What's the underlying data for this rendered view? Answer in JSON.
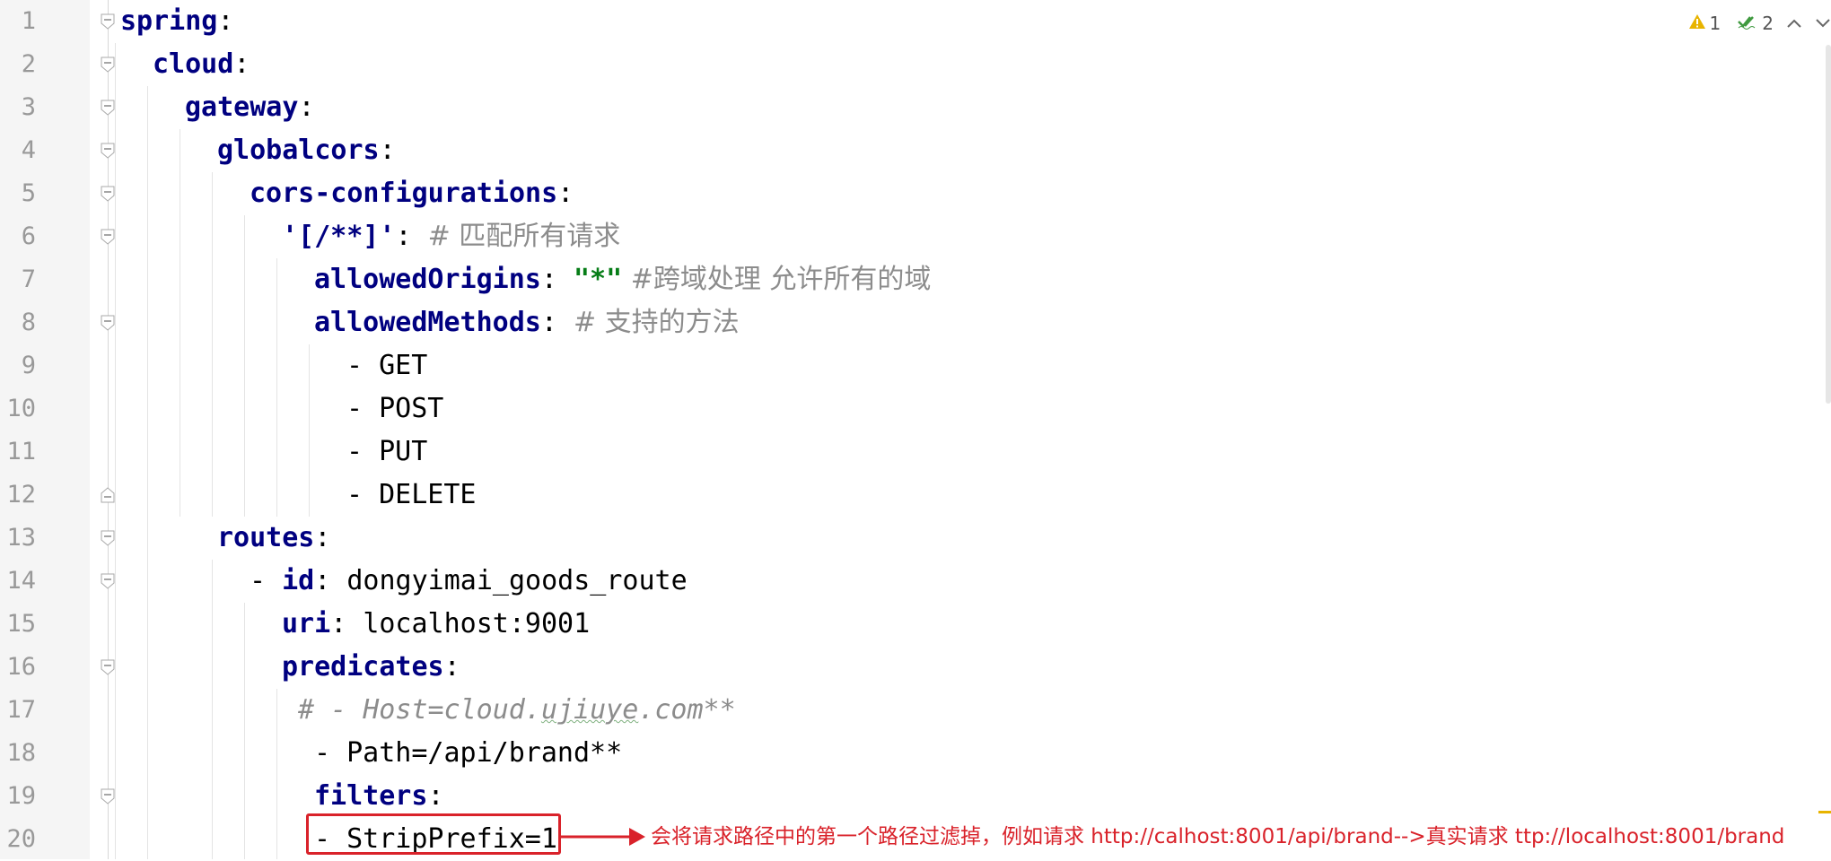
{
  "editor": {
    "inspections": {
      "warning_count": "1",
      "weak_warning_count": "2",
      "prev_icon": "chevron-up-icon",
      "next_icon": "chevron-down-icon"
    },
    "line_numbers": [
      "1",
      "2",
      "3",
      "4",
      "5",
      "6",
      "7",
      "8",
      "9",
      "10",
      "11",
      "12",
      "13",
      "14",
      "15",
      "16",
      "17",
      "18",
      "19",
      "20"
    ],
    "lines": {
      "l1": {
        "key": "spring",
        "colon": ":"
      },
      "l2": {
        "key": "cloud",
        "colon": ":"
      },
      "l3": {
        "key": "gateway",
        "colon": ":"
      },
      "l4": {
        "key": "globalcors",
        "colon": ":"
      },
      "l5": {
        "key": "cors-configurations",
        "colon": ":"
      },
      "l6": {
        "key": "'[/**]'",
        "colon": ": ",
        "comment": "# 匹配所有请求"
      },
      "l7": {
        "key": "allowedOrigins",
        "colon": ": ",
        "value": "\"*\"",
        "comment": " #跨域处理 允许所有的域"
      },
      "l8": {
        "key": "allowedMethods",
        "colon": ": ",
        "comment": "# 支持的方法"
      },
      "l9": {
        "text": "- GET"
      },
      "l10": {
        "text": "- POST"
      },
      "l11": {
        "text": "- PUT"
      },
      "l12": {
        "text": "- DELETE"
      },
      "l13": {
        "key": "routes",
        "colon": ":"
      },
      "l14": {
        "dash": "- ",
        "key": "id",
        "colon": ": ",
        "value": "dongyimai_goods_route"
      },
      "l15": {
        "key": "uri",
        "colon": ": ",
        "value": "localhost:9001"
      },
      "l16": {
        "key": "predicates",
        "colon": ":"
      },
      "l17": {
        "pre": "# - Host=cloud.",
        "squiggle": "ujiuye",
        "post": ".com**"
      },
      "l18": {
        "text": "- Path=/api/brand**"
      },
      "l19": {
        "key": "filters",
        "colon": ":"
      },
      "l20": {
        "text": "- StripPrefix=1"
      }
    }
  },
  "annotation": {
    "text": "会将请求路径中的第一个路径过滤掉，例如请求 http://calhost:8001/api/brand-->真实请求 ttp://localhost:8001/brand",
    "color": "#d9222a"
  }
}
